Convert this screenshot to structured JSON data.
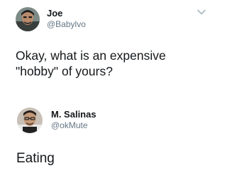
{
  "tweets": [
    {
      "display_name": "Joe",
      "handle": "@Babylvo",
      "text": "Okay, what is an expensive \"hobby\" of yours?",
      "avatar_icon": "profile-photo-avatar",
      "menu_icon": "chevron-down-icon"
    },
    {
      "display_name": "M. Salinas",
      "handle": "@okMute",
      "text": "Eating",
      "avatar_icon": "profile-photo-avatar"
    }
  ],
  "colors": {
    "text_primary": "#14171a",
    "text_secondary": "#657786",
    "chevron": "#aab8c2",
    "background": "#ffffff"
  }
}
